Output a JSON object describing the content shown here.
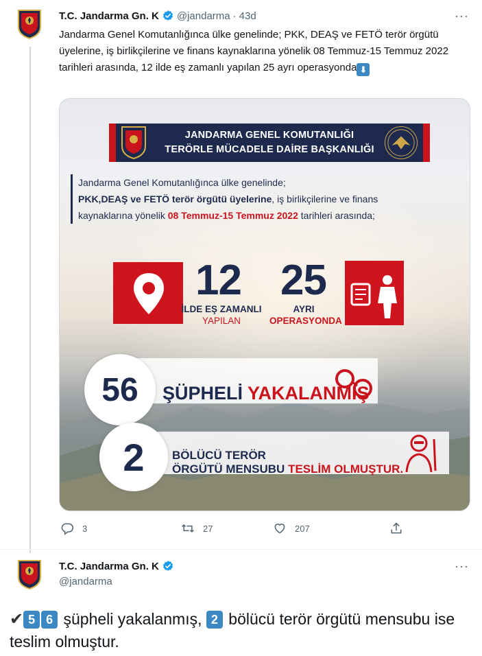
{
  "tweet1": {
    "author_name": "T.C. Jandarma Gn. K",
    "handle": "@jandarma",
    "separator": "·",
    "time": "43d",
    "more": "···",
    "text": "Jandarma Genel Komutanlığınca ülke genelinde; PKK, DEAŞ ve FETÖ terör örgütü üyelerine, iş birlikçilerine ve finans kaynaklarına yönelik 08 Temmuz-15 Temmuz 2022 tarihleri arasında, 12 ilde eş zamanlı yapılan 25 ayrı operasyonda",
    "emoji": "⬇",
    "replies": "3",
    "retweets": "27",
    "likes": "207"
  },
  "infographic": {
    "banner_line1": "JANDARMA GENEL KOMUTANLIĞI",
    "banner_line2": "TERÖRLE MÜCADELE DAİRE BAŞKANLIĞI",
    "intro_line1": "Jandarma Genel Komutanlığınca ülke genelinde;",
    "intro_bold": "PKK,DEAŞ ve FETÖ terör örgütü üyelerine",
    "intro_line2_rest": ", iş birlikçilerine ve finans",
    "intro_line3_start": "kaynaklarına yönelik ",
    "intro_dates": "08 Temmuz-15 Temmuz 2022",
    "intro_line3_end": " tarihleri arasında;",
    "stat1_number": "12",
    "stat1_label_a": "İLDE EŞ ZAMANLI",
    "stat1_label_b": "YAPILAN",
    "stat2_number": "25",
    "stat2_label_a": "AYRI",
    "stat2_label_b": "OPERASYONDA",
    "stat3_number": "56",
    "stat3_label_a": "ŞÜPHELİ ",
    "stat3_label_b": "YAKALANMIŞ",
    "stat4_number": "2",
    "stat4_line1": "BÖLÜCÜ TERÖR",
    "stat4_line2_a": "ÖRGÜTÜ MENSUBU ",
    "stat4_line2_b": "TESLİM OLMUŞTUR."
  },
  "tweet2": {
    "author_name": "T.C. Jandarma Gn. K",
    "handle": "@jandarma",
    "more": "···",
    "check": "✔",
    "digit_5": "5",
    "digit_6": "6",
    "digit_2": "2",
    "text_a": " şüpheli yakalanmış, ",
    "text_b": " bölücü terör örgütü mensubu ise teslim olmuştur."
  },
  "colors": {
    "accent": "#1d9bf0",
    "navy": "#1d2a4d",
    "red": "#c9141e",
    "muted": "#536471"
  },
  "icons": [
    "jandarma-emblem-icon",
    "verified-badge-icon",
    "reply-icon",
    "retweet-icon",
    "like-icon",
    "share-icon",
    "location-pin-icon",
    "document-soldier-icon",
    "handcuffs-icon",
    "masked-terrorist-icon"
  ]
}
